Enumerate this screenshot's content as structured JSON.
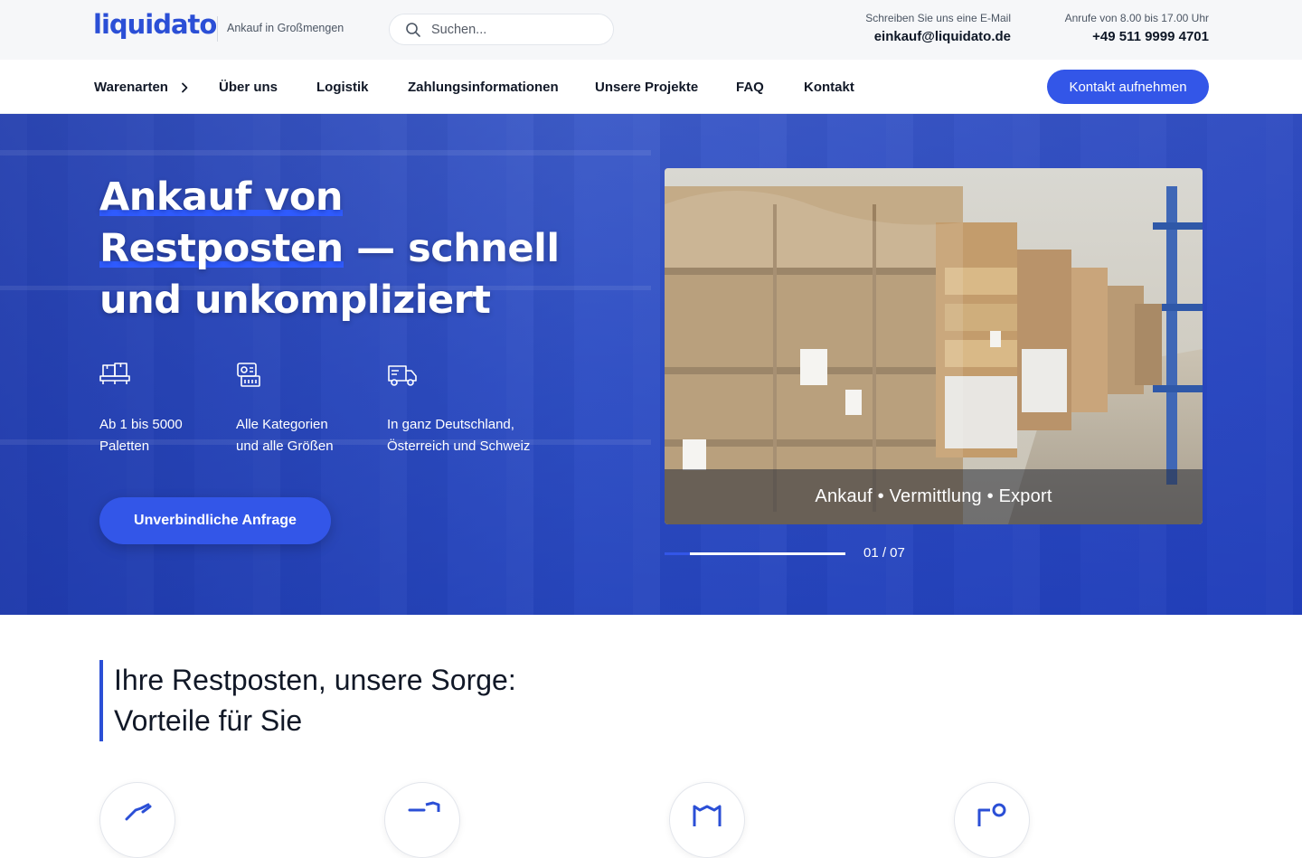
{
  "brand": {
    "logo": "liquidato",
    "tagline": "Ankauf in Großmengen"
  },
  "search": {
    "placeholder": "Suchen..."
  },
  "contact": {
    "email_label": "Schreiben Sie uns eine E-Mail",
    "email": "einkauf@liquidato.de",
    "phone_label": "Anrufe von 8.00 bis 17.00 Uhr",
    "phone": "+49 511 9999 4701"
  },
  "nav": {
    "items": [
      "Warenarten",
      "Über uns",
      "Logistik",
      "Zahlungsinformationen",
      "Unsere Projekte",
      "FAQ",
      "Kontakt"
    ],
    "cta": "Kontakt aufnehmen"
  },
  "hero": {
    "title_part1": "Ankauf von",
    "title_part2": "Restposten",
    "title_part3": " — schnell und unkompliziert",
    "features": [
      {
        "icon": "pallet-icon",
        "line1": "Ab 1 bis 5000",
        "line2": "Paletten"
      },
      {
        "icon": "categories-icon",
        "line1": "Alle Kategorien",
        "line2": "und alle Größen"
      },
      {
        "icon": "delivery-truck-icon",
        "line1": "In ganz Deutschland,",
        "line2": "Österreich und Schweiz"
      }
    ],
    "cta": "Unverbindliche Anfrage",
    "slide_caption": "Ankauf • Vermittlung • Export",
    "slide_counter": "01 / 07",
    "slide_progress": 0.14
  },
  "benefits": {
    "title_line1": "Ihre Restposten, unsere Sorge:",
    "title_line2": "Vorteile für Sie",
    "icons": [
      "handshake-icon",
      "shield-truck-icon",
      "warehouse-icon",
      "people-icon"
    ]
  },
  "colors": {
    "accent": "#3356e8",
    "brand": "#2b4fd6"
  }
}
